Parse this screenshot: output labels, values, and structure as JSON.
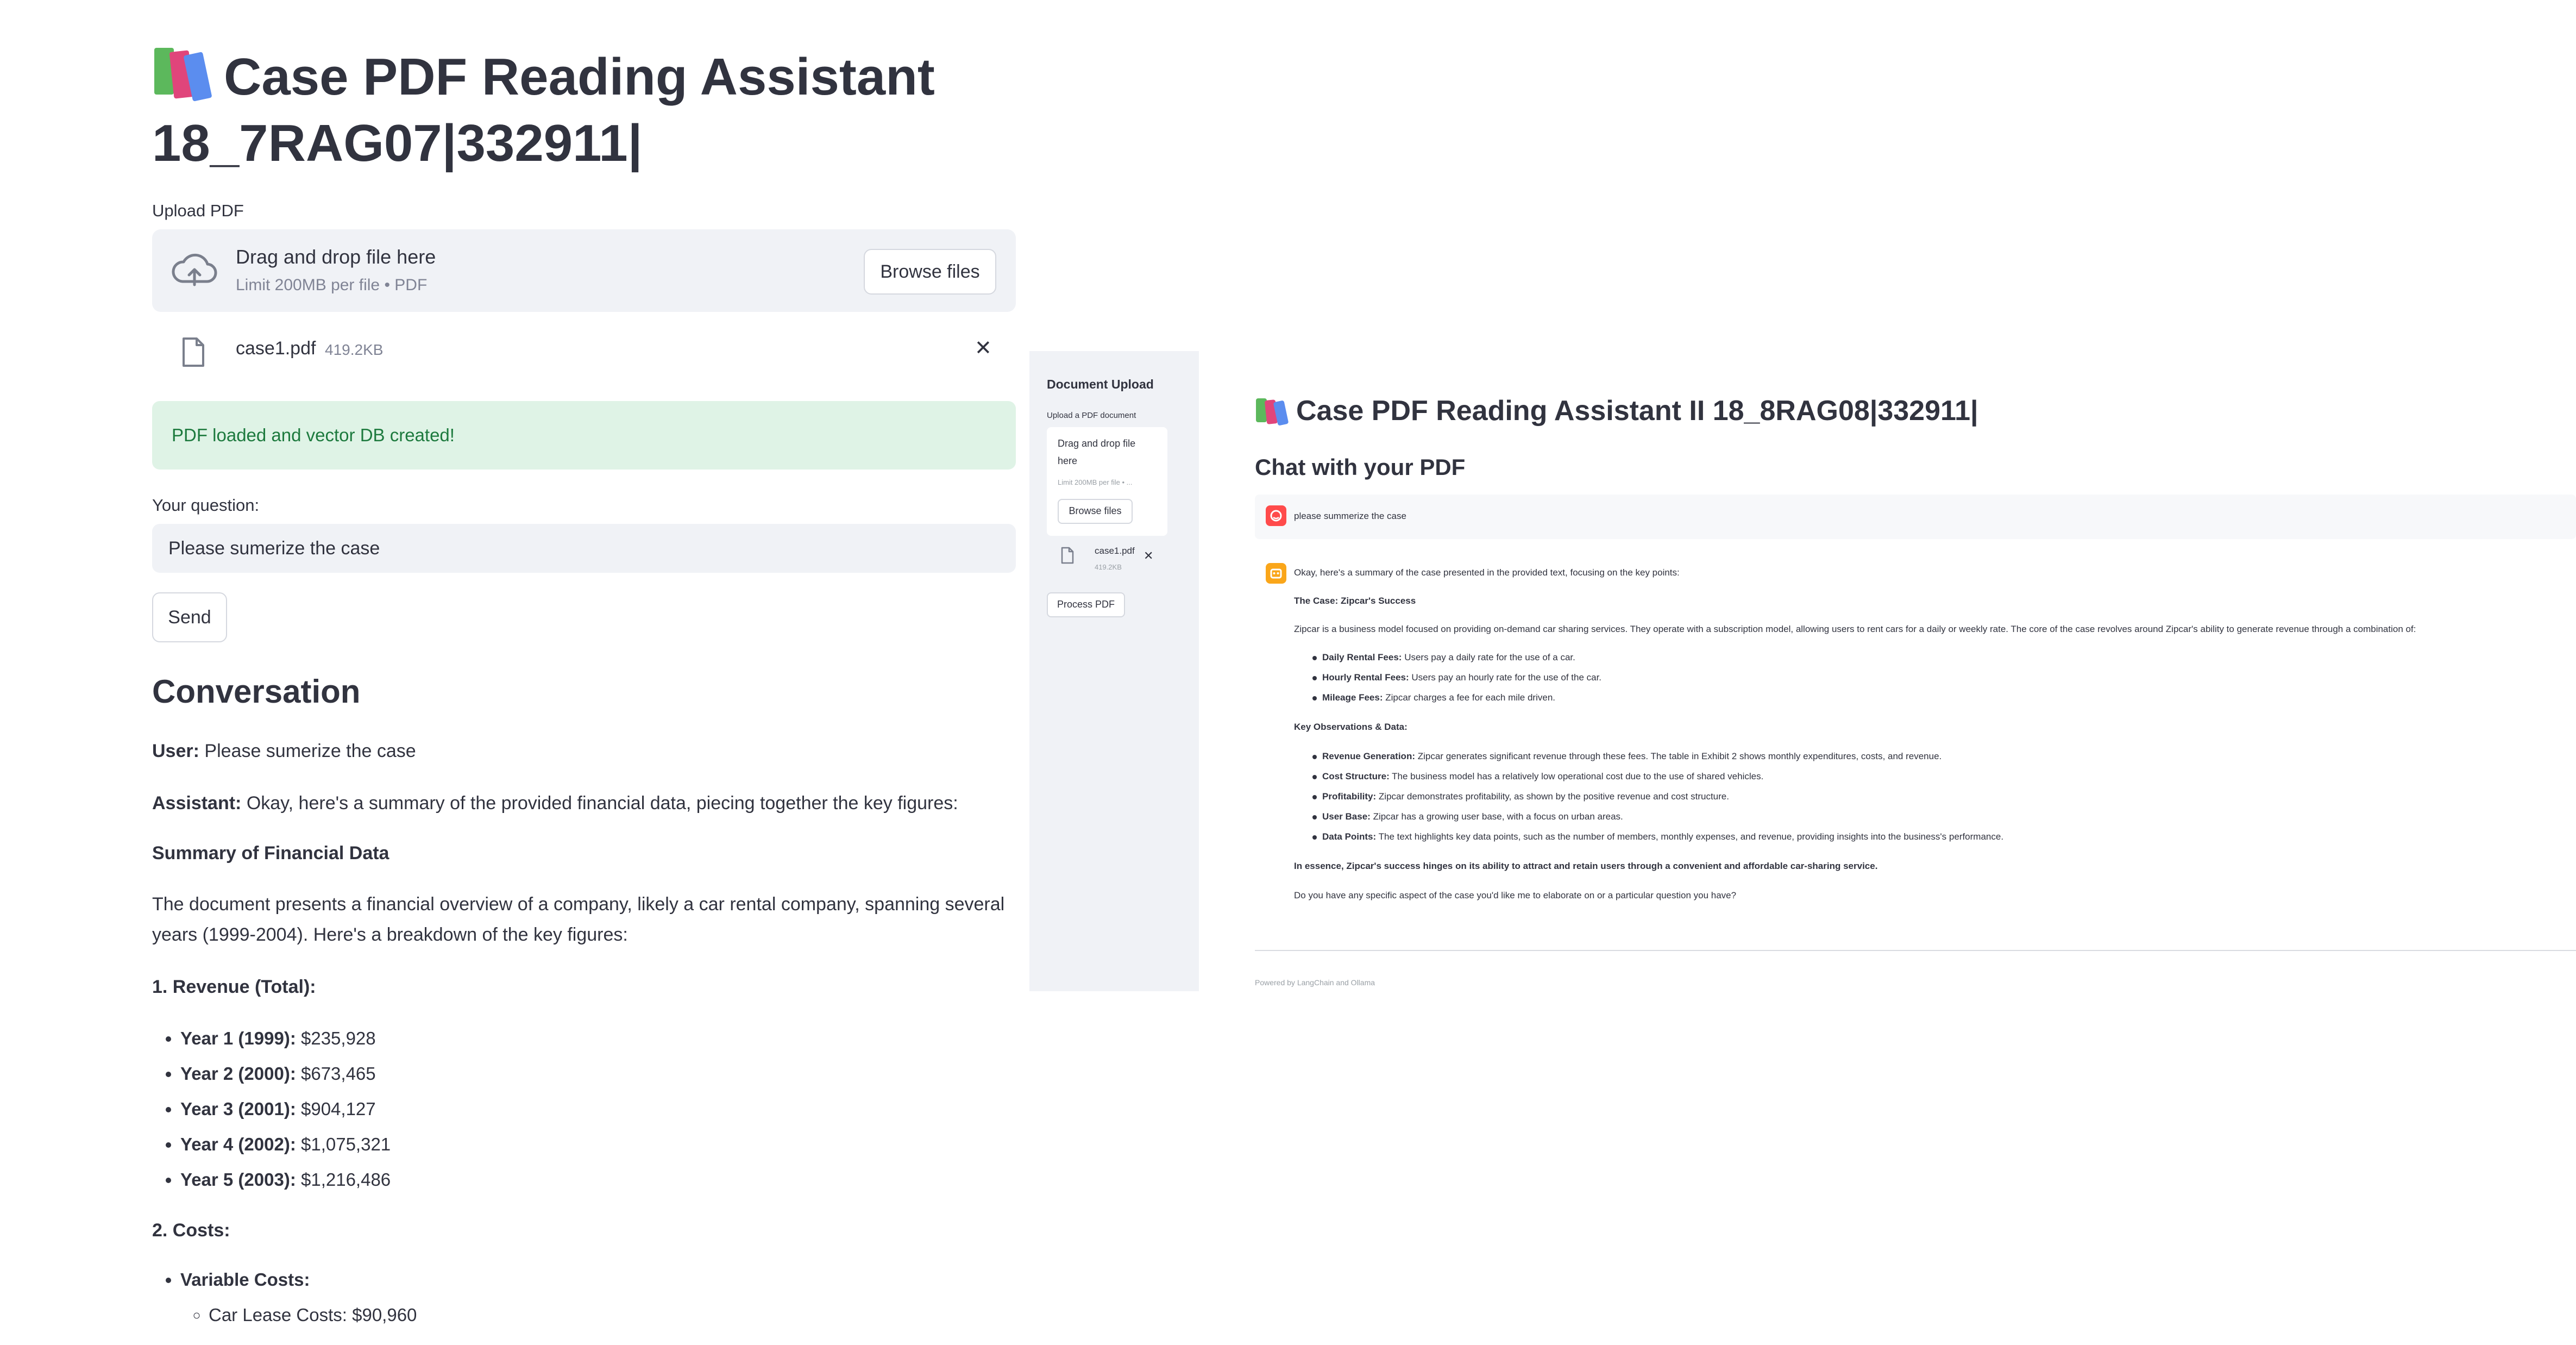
{
  "app1": {
    "title": "Case PDF Reading Assistant",
    "title_line2": "18_7RAG07|332911|",
    "upload_label": "Upload PDF",
    "dropzone": {
      "title": "Drag and drop file here",
      "subtitle": "Limit 200MB per file • PDF",
      "browse_label": "Browse files"
    },
    "file": {
      "name": "case1.pdf",
      "size": "419.2KB",
      "remove": "✕"
    },
    "success_message": "PDF loaded and vector DB created!",
    "question_label": "Your question:",
    "question_value": "Please sumerize the case",
    "send_label": "Send",
    "conversation_heading": "Conversation",
    "user_prefix": "User:",
    "user_message": "Please sumerize the case",
    "assistant_prefix": "Assistant:",
    "assistant_intro": "Okay, here's a summary of the provided financial data, piecing together the key figures:",
    "summary_heading": "Summary of Financial Data",
    "overview_line1": "The document presents a financial overview of a company, likely a car rental company, spanning several",
    "overview_line2": "years (1999-2004). Here's a breakdown of the key figures:",
    "revenue_heading": "1. Revenue (Total):",
    "revenue_items": [
      {
        "label": "Year 1 (1999):",
        "value": "$235,928"
      },
      {
        "label": "Year 2 (2000):",
        "value": "$673,465"
      },
      {
        "label": "Year 3 (2001):",
        "value": "$904,127"
      },
      {
        "label": "Year 4 (2002):",
        "value": "$1,075,321"
      },
      {
        "label": "Year 5 (2003):",
        "value": "$1,216,486"
      }
    ],
    "costs_heading": "2. Costs:",
    "variable_costs_label": "Variable Costs:",
    "car_lease_label": "Car Lease Costs: $90,960"
  },
  "sidebar": {
    "title": "Document Upload",
    "upload_label": "Upload a PDF document",
    "dropzone_line1": "Drag and drop file",
    "dropzone_line2": "here",
    "dropzone_limit": "Limit 200MB per file • ...",
    "browse_label": "Browse files",
    "file_name": "case1.pdf",
    "file_size": "419.2KB",
    "remove": "✕",
    "process_label": "Process PDF"
  },
  "app2": {
    "title": "Case PDF Reading Assistant II 18_8RAG08|332911|",
    "subheading": "Chat with your PDF",
    "user_message": "please summerize the case",
    "intro": "Okay, here's a summary of the case presented in the provided text, focusing on the key points:",
    "case_heading": "The Case: Zipcar's Success",
    "case_paragraph": "Zipcar is a business model focused on providing on-demand car sharing services. They operate with a subscription model, allowing users to rent cars for a daily or weekly rate. The core of the case revolves around Zipcar's ability to generate revenue through a combination of:",
    "fee_items": [
      {
        "label": "Daily Rental Fees:",
        "text": "Users pay a daily rate for the use of a car."
      },
      {
        "label": "Hourly Rental Fees:",
        "text": "Users pay an hourly rate for the use of the car."
      },
      {
        "label": "Mileage Fees:",
        "text": "Zipcar charges a fee for each mile driven."
      }
    ],
    "observations_heading": "Key Observations & Data:",
    "observation_items": [
      {
        "label": "Revenue Generation:",
        "text": "Zipcar generates significant revenue through these fees. The table in Exhibit 2 shows monthly expenditures, costs, and revenue."
      },
      {
        "label": "Cost Structure:",
        "text": "The business model has a relatively low operational cost due to the use of shared vehicles."
      },
      {
        "label": "Profitability:",
        "text": "Zipcar demonstrates profitability, as shown by the positive revenue and cost structure."
      },
      {
        "label": "User Base:",
        "text": "Zipcar has a growing user base, with a focus on urban areas."
      },
      {
        "label": "Data Points:",
        "text": "The text highlights key data points, such as the number of members, monthly expenses, and revenue, providing insights into the business's performance."
      }
    ],
    "essence": "In essence, Zipcar's success hinges on its ability to attract and retain users through a convenient and affordable car-sharing service.",
    "closing_question": "Do you have any specific aspect of the case you'd like me to elaborate on or a particular question you have?",
    "footer": "Powered by LangChain and Ollama"
  },
  "colors": {
    "text": "#31333f",
    "secondary_background": "#f0f2f6",
    "success_background": "#dff3e6",
    "success_text": "#1d7a3e",
    "user_avatar": "#ff4b4b",
    "assistant_avatar": "#faa61a"
  },
  "icons": [
    "books-icon",
    "cloud-upload-icon",
    "file-icon",
    "close-icon",
    "user-avatar-icon",
    "assistant-avatar-icon"
  ]
}
